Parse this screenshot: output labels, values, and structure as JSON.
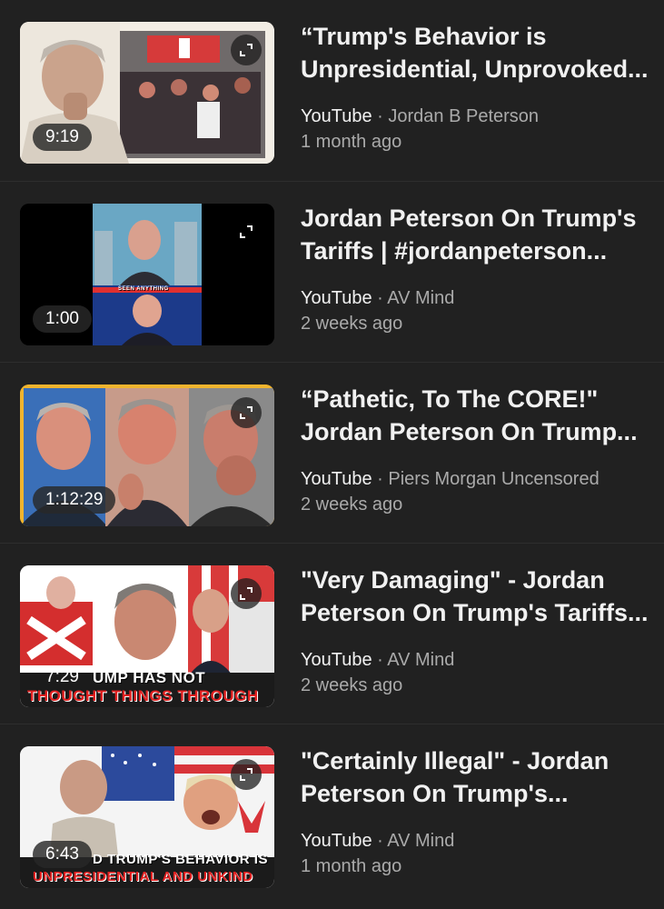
{
  "videos": [
    {
      "title_line1": "“Trump's Behavior is",
      "title_line2": "Unpresidential, Unprovoked...",
      "platform": "YouTube",
      "channel": "Jordan B Peterson",
      "age": "1 month ago",
      "duration": "9:19",
      "thumbnail_captions": []
    },
    {
      "title_line1": "Jordan Peterson On Trump's",
      "title_line2": "Tariffs | #jordanpeterson...",
      "platform": "YouTube",
      "channel": "AV Mind",
      "age": "2 weeks ago",
      "duration": "1:00",
      "thumbnail_captions": [
        "SEEN ANYTHING"
      ]
    },
    {
      "title_line1": "“Pathetic, To The CORE!\"",
      "title_line2": "Jordan Peterson On Trump...",
      "platform": "YouTube",
      "channel": "Piers Morgan Uncensored",
      "age": "2 weeks ago",
      "duration": "1:12:29",
      "thumbnail_captions": []
    },
    {
      "title_line1": "\"Very Damaging\" - Jordan",
      "title_line2": "Peterson On Trump's Tariffs...",
      "platform": "YouTube",
      "channel": "AV Mind",
      "age": "2 weeks ago",
      "duration": "7:29",
      "thumbnail_captions": [
        "UMP HAS NOT",
        "THOUGHT THINGS THROUGH"
      ]
    },
    {
      "title_line1": "\"Certainly Illegal\" - Jordan",
      "title_line2": "Peterson On Trump's...",
      "platform": "YouTube",
      "channel": "AV Mind",
      "age": "1 month ago",
      "duration": "6:43",
      "thumbnail_captions": [
        "D TRUMP'S BEHAVIOR IS",
        "UNPRESIDENTIAL AND UNKIND"
      ]
    }
  ],
  "separator": " · ",
  "icons": {
    "expand": "expand-icon"
  },
  "colors": {
    "background": "#212121",
    "primary_text": "#f1f1f1",
    "secondary_text": "#aaaaaa"
  }
}
